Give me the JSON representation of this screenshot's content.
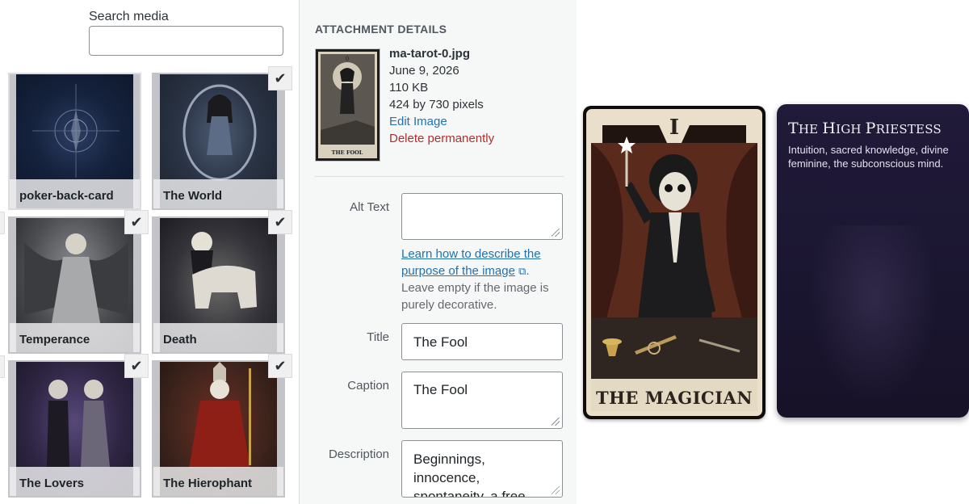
{
  "media": {
    "search_label": "Search media",
    "search_value": "",
    "items": [
      {
        "label": "poker-back-card",
        "selected": false
      },
      {
        "label": "The World",
        "selected": true
      },
      {
        "label": "Temperance",
        "selected": true
      },
      {
        "label": "Death",
        "selected": true
      },
      {
        "label": "The Lovers",
        "selected": true
      },
      {
        "label": "The Hierophant",
        "selected": true
      }
    ],
    "check_glyph": "✔"
  },
  "details": {
    "heading": "ATTACHMENT DETAILS",
    "filename": "ma-tarot-0.jpg",
    "date": "June 9, 2026",
    "filesize": "110 KB",
    "dimensions": "424 by 730 pixels",
    "edit_link": "Edit Image",
    "delete_link": "Delete permanently",
    "thumb_number": "0",
    "thumb_caption": "THE FOOL",
    "alt_text": {
      "label": "Alt Text",
      "value": ""
    },
    "help": {
      "link_text": "Learn how to describe the purpose of the image",
      "after_link": ".",
      "tail": "Leave empty if the image is purely decorative."
    },
    "title": {
      "label": "Title",
      "value": "The Fool"
    },
    "caption": {
      "label": "Caption",
      "value": "The Fool"
    },
    "description": {
      "label": "Description",
      "value": "Beginnings, innocence, spontaneity, a free"
    }
  },
  "cards": {
    "magician": {
      "number": "I",
      "title": "THE MAGICIAN"
    },
    "priestess": {
      "title_first": "T",
      "title_rest": "HE ",
      "title_h": "H",
      "title_igh": "IGH ",
      "title_p": "P",
      "title_riestess": "RIESTESS",
      "description": "Intuition, sacred knowledge, divine feminine, the subconscious mind."
    }
  },
  "colors": {
    "link": "#2271b1",
    "delete": "#b32d2e",
    "panel_bg": "#f6f7f7",
    "priestess_bg": "#1c1733"
  }
}
